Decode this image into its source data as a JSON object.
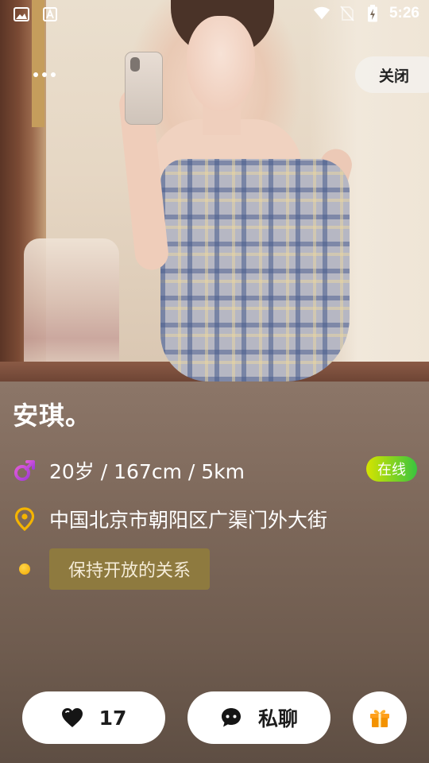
{
  "status_bar": {
    "time": "5:26",
    "left_icons": [
      "gallery-icon",
      "font-icon"
    ],
    "right_icons": [
      "wifi-icon",
      "no-sim-icon",
      "battery-charging-icon"
    ]
  },
  "top_bar": {
    "more_icon": "more-horizontal-icon",
    "close_label": "关闭"
  },
  "profile": {
    "name": "安琪。",
    "stats": "20岁 / 167cm / 5km",
    "gender_icon": "male-icon",
    "online_label": "在线",
    "location": "中国北京市朝阳区广渠门外大街",
    "location_icon": "location-pin-icon",
    "tag": "保持开放的关系"
  },
  "actions": {
    "like_count": "17",
    "like_icon": "heart-icon",
    "chat_label": "私聊",
    "chat_icon": "chat-bubble-icon",
    "gift_icon": "gift-icon"
  },
  "colors": {
    "online_gradient_start": "#d6e400",
    "online_gradient_end": "#39c43f",
    "tag_chip": "#8e7a3f",
    "male_icon": "#c548d8",
    "location_icon": "#f4b400",
    "gift_icon": "#f39200"
  }
}
